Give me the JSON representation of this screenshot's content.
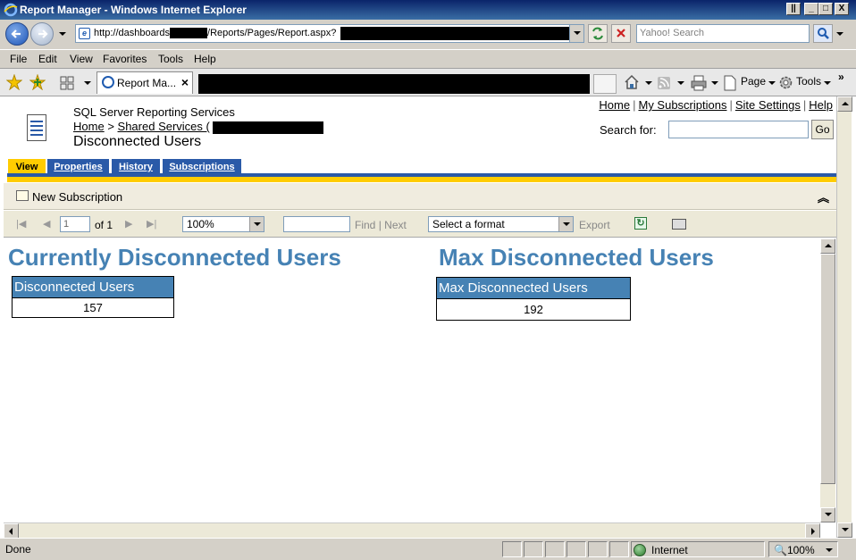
{
  "window": {
    "title": "Report Manager - Windows Internet Explorer"
  },
  "address": {
    "url_prefix": "http://dashboards",
    "url_middle": "/Reports/Pages/Report.aspx?",
    "search_placeholder": "Yahoo! Search"
  },
  "menu": [
    "File",
    "Edit",
    "View",
    "Favorites",
    "Tools",
    "Help"
  ],
  "tab": {
    "label": "Report Ma...",
    "close": "×"
  },
  "commandbar": {
    "page_label": "Page",
    "tools_label": "Tools"
  },
  "rm": {
    "product": "SQL Server Reporting Services",
    "breadcrumb_home": "Home",
    "breadcrumb_sep": ">",
    "breadcrumb_folder": "Shared Services (",
    "page_title": "Disconnected Users",
    "links": [
      "Home",
      "My Subscriptions",
      "Site Settings",
      "Help"
    ],
    "link_sep": "|",
    "search_label": "Search for:",
    "go": "Go",
    "tabs": [
      "View",
      "Properties",
      "History",
      "Subscriptions"
    ],
    "new_subscription": "New Subscription"
  },
  "report_toolbar": {
    "page_value": "1",
    "of_text": "of 1",
    "zoom": "100%",
    "find": "Find",
    "sep": "|",
    "next": "Next",
    "format": "Select a format",
    "export": "Export"
  },
  "report": {
    "left_heading": "Currently Disconnected Users",
    "left_col_header": "Disconnected Users",
    "left_value": "157",
    "right_heading": "Max Disconnected Users",
    "right_col_header": "Max Disconnected Users",
    "right_value": "192"
  },
  "status": {
    "text": "Done",
    "zone": "Internet",
    "zoom": "100%"
  },
  "colors": {
    "report_blue": "#4682b4",
    "tab_blue": "#2a5aa8",
    "tab_yellow": "#ffcc00"
  }
}
